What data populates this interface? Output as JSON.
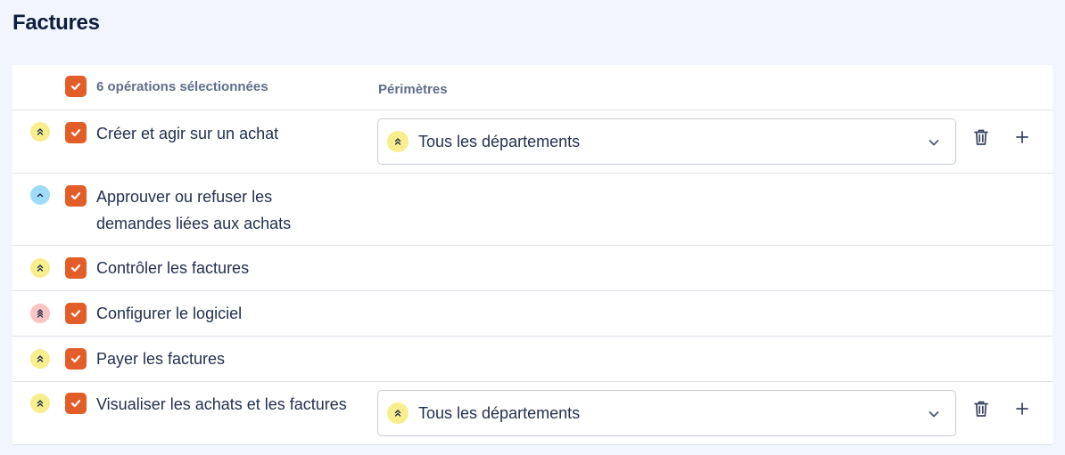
{
  "page": {
    "title": "Factures"
  },
  "table": {
    "selected_label": "6 opérations sélectionnées",
    "perimeter_header": "Périmètres",
    "rows": [
      {
        "level_icon": "double-chevron-up-icon",
        "level_color": "#f9ee8e",
        "label_lines": [
          "Créer et agir sur un achat"
        ],
        "checked": true,
        "perimeter": "Tous les départements"
      },
      {
        "level_icon": "chevron-up-icon",
        "level_color": "#9fdcfb",
        "label_lines": [
          "Approuver ou refuser les",
          "demandes liées aux achats"
        ],
        "checked": true
      },
      {
        "level_icon": "double-chevron-up-icon",
        "level_color": "#f9ee8e",
        "label_lines": [
          "Contrôler les factures"
        ],
        "checked": true
      },
      {
        "level_icon": "triple-chevron-up-icon",
        "level_color": "#f9c4c4",
        "label_lines": [
          "Configurer le logiciel"
        ],
        "checked": true
      },
      {
        "level_icon": "double-chevron-up-icon",
        "level_color": "#f9ee8e",
        "label_lines": [
          "Payer les factures"
        ],
        "checked": true
      },
      {
        "level_icon": "double-chevron-up-icon",
        "level_color": "#f9ee8e",
        "label_lines": [
          "Visualiser les achats et les factures"
        ],
        "checked": true,
        "perimeter": "Tous les départements"
      }
    ]
  },
  "icons": {
    "delete": "trash-icon",
    "add": "plus-icon",
    "dropdown": "chevron-down-icon",
    "checkbox": "checkmark-icon"
  },
  "colors": {
    "accent": "#e35d29",
    "background": "#f1f5fd",
    "text": "#22314f",
    "muted": "#5f6f8c"
  }
}
